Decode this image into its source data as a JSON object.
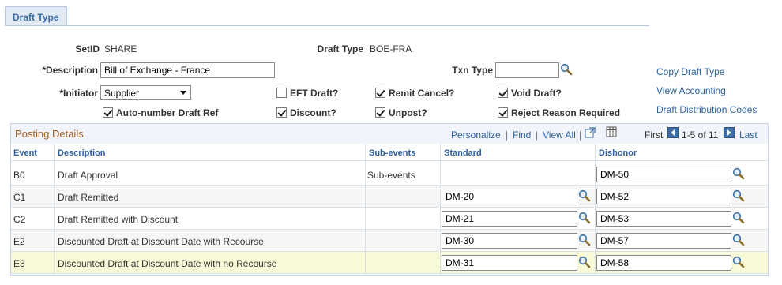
{
  "tab": {
    "label": "Draft Type"
  },
  "header": {
    "setid_label": "SetID",
    "setid_value": "SHARE",
    "drafttype_label": "Draft Type",
    "drafttype_value": "BOE-FRA",
    "description_label": "*Description",
    "description_value": "Bill of Exchange - France",
    "txntype_label": "Txn Type",
    "txntype_value": "",
    "initiator_label": "*Initiator",
    "initiator_value": "Supplier"
  },
  "checkboxes": {
    "eft": {
      "label": "EFT Draft?",
      "checked": false
    },
    "remit_cancel": {
      "label": "Remit Cancel?",
      "checked": true
    },
    "void": {
      "label": "Void Draft?",
      "checked": true
    },
    "autonumber": {
      "label": "Auto-number Draft Ref",
      "checked": true
    },
    "discount": {
      "label": "Discount?",
      "checked": true
    },
    "unpost": {
      "label": "Unpost?",
      "checked": true
    },
    "reject": {
      "label": "Reject Reason Required",
      "checked": true
    }
  },
  "links": {
    "copy": "Copy Draft Type",
    "view_accounting": "View Accounting",
    "distribution": "Draft Distribution Codes"
  },
  "grid": {
    "title": "Posting Details",
    "personalize": "Personalize",
    "sep1": "|",
    "find": "Find",
    "sep2": "|",
    "view_all": "View All",
    "sep3": "|",
    "first": "First",
    "range": "1-5 of 11",
    "last": "Last",
    "columns": {
      "event": "Event",
      "description": "Description",
      "subevents": "Sub-events",
      "standard": "Standard",
      "dishonor": "Dishonor"
    },
    "rows": [
      {
        "event": "B0",
        "description": "Draft Approval",
        "subevents": "Sub-events",
        "standard": "",
        "dishonor": "DM-50"
      },
      {
        "event": "C1",
        "description": "Draft Remitted",
        "subevents": "",
        "standard": "DM-20",
        "dishonor": "DM-52"
      },
      {
        "event": "C2",
        "description": "Draft Remitted with Discount",
        "subevents": "",
        "standard": "DM-21",
        "dishonor": "DM-53"
      },
      {
        "event": "E2",
        "description": "Discounted Draft at Discount Date with Recourse",
        "subevents": "",
        "standard": "DM-30",
        "dishonor": "DM-57"
      },
      {
        "event": "E3",
        "description": "Discounted Draft at Discount Date with no Recourse",
        "subevents": "",
        "standard": "DM-31",
        "dishonor": "DM-58"
      }
    ]
  },
  "colors": {
    "accent": "#2b5f9e",
    "title": "#a55f24",
    "highlight": "#f8f9d6"
  }
}
